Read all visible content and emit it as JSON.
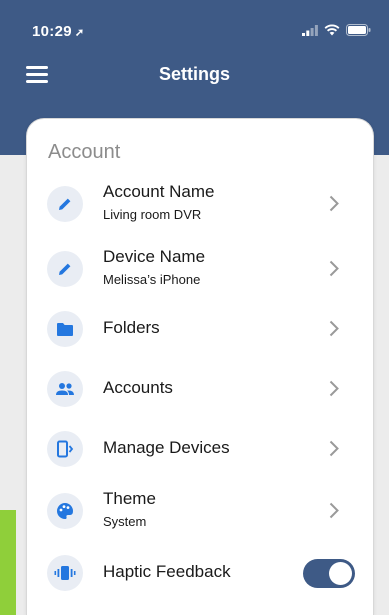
{
  "status_bar": {
    "time": "10:29",
    "location_glyph": "➚"
  },
  "header": {
    "title": "Settings",
    "menu_icon": "hamburger-menu-icon"
  },
  "colors": {
    "header_bg": "#3e5a86",
    "icon_blue": "#2477df",
    "icon_bg": "#e9edf4",
    "toggle_on": "#3e5a86"
  },
  "account_section": {
    "title": "Account",
    "items": [
      {
        "title": "Account Name",
        "subtitle": "Living room DVR",
        "icon": "pencil-icon"
      },
      {
        "title": "Device Name",
        "subtitle": "Melissa’s iPhone",
        "icon": "pencil-icon"
      },
      {
        "title": "Folders",
        "icon": "folder-icon"
      },
      {
        "title": "Accounts",
        "icon": "people-icon"
      },
      {
        "title": "Manage Devices",
        "icon": "device-sync-icon"
      },
      {
        "title": "Theme",
        "subtitle": "System",
        "icon": "palette-icon"
      },
      {
        "title": "Haptic Feedback",
        "icon": "vibration-icon",
        "toggle": true
      }
    ]
  }
}
